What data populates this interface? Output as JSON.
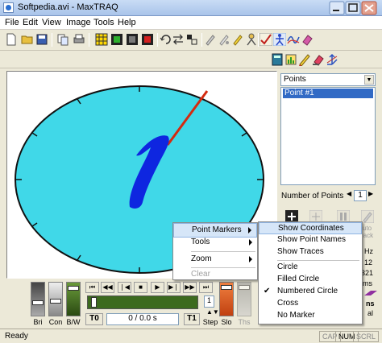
{
  "window": {
    "title": "Softpedia.avi - MaxTRAQ",
    "buttons": [
      "_",
      "□",
      "×"
    ]
  },
  "menu": [
    "File",
    "Edit",
    "View",
    "Image",
    "Tools",
    "Help"
  ],
  "points_panel": {
    "dropdown_label": "Points",
    "list_items": [
      "Point #1"
    ],
    "number_of_points_label": "Number of Points",
    "number_of_points_value": "1"
  },
  "context_menu": {
    "items": [
      {
        "label": "Point Markers",
        "highlighted": true,
        "has_submenu": true,
        "disabled": false
      },
      {
        "label": "Tools",
        "highlighted": false,
        "has_submenu": true,
        "disabled": false
      },
      {
        "label": "Zoom",
        "highlighted": false,
        "has_submenu": true,
        "disabled": false
      },
      {
        "label": "Clear",
        "highlighted": false,
        "has_submenu": false,
        "disabled": true
      }
    ]
  },
  "submenu": {
    "items": [
      {
        "label": "Show Coordinates",
        "highlighted": true,
        "checked": false
      },
      {
        "label": "Show Point Names",
        "highlighted": false,
        "checked": false
      },
      {
        "label": "Show Traces",
        "highlighted": false,
        "checked": false
      },
      {
        "label": "Circle",
        "highlighted": false,
        "checked": false
      },
      {
        "label": "Filled Circle",
        "highlighted": false,
        "checked": false
      },
      {
        "label": "Numbered Circle",
        "highlighted": false,
        "checked": true
      },
      {
        "label": "Cross",
        "highlighted": false,
        "checked": false
      },
      {
        "label": "No Marker",
        "highlighted": false,
        "checked": false
      }
    ],
    "check_glyph": "✔"
  },
  "video_controls": {
    "slider_labels": [
      "Bri",
      "Con",
      "B/W"
    ],
    "t0_label": "T0",
    "t1_label": "T1",
    "time_display": "0  /  0.0 s",
    "step_value": "1",
    "step_label": "Step",
    "slo_label": "Slo",
    "ths_label": "Ths"
  },
  "side_partial_text": {
    "hz": "Hz",
    "v12": "12",
    "v321": "321",
    "ms": "ms",
    "auto": "uto",
    "rack": "rack",
    "al": "al"
  },
  "statusbar": {
    "status": "Ready",
    "indicators": [
      "CAP",
      "NUM",
      "SCRL"
    ]
  },
  "colors": {
    "clock_face": "#40d8e8",
    "hand": "#d42a10",
    "marker": "#0e26e0",
    "timeline": "#3c6a1e",
    "highlight": "#d6e6f8"
  }
}
